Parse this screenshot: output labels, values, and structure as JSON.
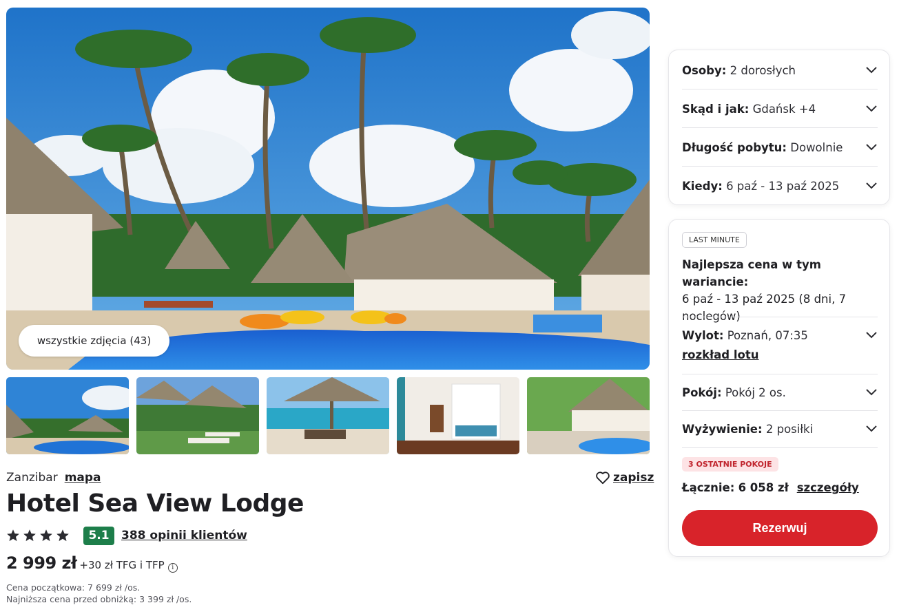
{
  "gallery": {
    "all_photos_label": "wszystkie zdjęcia (43)",
    "thumbnails": [
      "pool-resort",
      "beach-umbrellas-lawn",
      "beach-umbrella-sea",
      "bedroom-canopy-bed",
      "garden-pool-bungalow"
    ]
  },
  "hotel": {
    "location": "Zanzibar",
    "map_link": "mapa",
    "save_label": "zapisz",
    "name": "Hotel Sea View Lodge",
    "stars": 4,
    "score": "5.1",
    "reviews_label": "388 opinii klientów",
    "price": "2 999 zł",
    "price_extra": "+30 zł TFG i TFP",
    "price_info_icon": "info-icon",
    "initial_price_note": "Cena początkowa: 7 699 zł /os.",
    "lowest_price_note": "Najniższa cena przed obniżką: 3 399 zł /os."
  },
  "search": {
    "persons_label": "Osoby:",
    "persons_value": "2 dorosłych",
    "from_label": "Skąd i jak:",
    "from_value": "Gdańsk +4",
    "duration_label": "Długość pobytu:",
    "duration_value": "Dowolnie",
    "when_label": "Kiedy:",
    "when_value": "6 paź - 13 paź 2025"
  },
  "offer": {
    "badge": "LAST MINUTE",
    "best_price_label": "Najlepsza cena w tym wariancie:",
    "best_price_dates": "6 paź - 13 paź 2025 (8 dni, 7 noclegów)",
    "flight_label": "Wylot:",
    "flight_value": "Poznań, 07:35",
    "flight_schedule_link": "rozkład lotu",
    "room_label": "Pokój:",
    "room_value": "Pokój 2 os.",
    "board_label": "Wyżywienie:",
    "board_value": "2 posiłki",
    "rooms_left_badge": "3 OSTATNIE POKOJE",
    "total_label": "Łącznie:",
    "total_value": "6 058 zł",
    "details_link": "szczegóły",
    "book_button": "Rezerwuj"
  },
  "colors": {
    "accent_red": "#d8232a",
    "score_green": "#1d7e4a",
    "rooms_left_bg": "#fde3e5"
  }
}
